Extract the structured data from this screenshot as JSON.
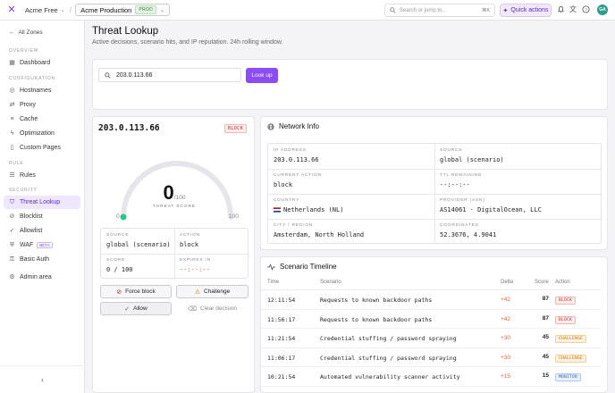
{
  "topbar": {
    "org": "Acme Free",
    "env": "Acme Production",
    "env_badge": "PROD",
    "search_placeholder": "Search or jump to...",
    "search_shortcut": "⌘K",
    "quick_actions": "Quick actions",
    "avatar": "GA"
  },
  "sidebar": {
    "back": "All Zones",
    "sections": {
      "overview": "OVERVIEW",
      "configuration": "CONFIGURATION",
      "rule": "RULE",
      "security": "SECURITY"
    },
    "items": {
      "dashboard": "Dashboard",
      "hostnames": "Hostnames",
      "proxy": "Proxy",
      "cache": "Cache",
      "optimization": "Optimization",
      "custom_pages": "Custom Pages",
      "rules": "Rules",
      "threat_lookup": "Threat Lookup",
      "blocklist": "Blocklist",
      "allowlist": "Allowlist",
      "waf": "WAF",
      "waf_badge": "BETA",
      "basic_auth": "Basic Auth",
      "admin_area": "Admin area"
    }
  },
  "page": {
    "title": "Threat Lookup",
    "subtitle": "Active decisions, scenario hits, and IP reputation. 24h rolling window."
  },
  "lookup": {
    "value": "203.0.113.66",
    "button": "Look up"
  },
  "ipcard": {
    "ip": "203.0.113.66",
    "status": "BLOCK",
    "score": "0",
    "score_max": "/100",
    "score_label": "THREAT SCORE",
    "gauge_min": "0",
    "gauge_max": "100",
    "score_value": 0,
    "source_label": "SOURCE",
    "source": "global (scenario)",
    "action_label": "ACTION",
    "action": "block",
    "score2_label": "SCORE",
    "score2": "0 / 100",
    "expires_label": "EXPIRES IN",
    "expires": "--:--:--",
    "force_block": "Force block",
    "challenge": "Challenge",
    "allow": "Allow",
    "clear": "Clear decision"
  },
  "network": {
    "title": "Network Info",
    "ip_label": "IP ADDRESS",
    "ip": "203.0.113.66",
    "source_label": "SOURCE",
    "source": "global (scenario)",
    "current_action_label": "CURRENT ACTION",
    "current_action": "block",
    "ttl_label": "TTL REMAINING",
    "ttl": "--:--:--",
    "country_label": "COUNTRY",
    "country": "Netherlands (NL)",
    "provider_label": "PROVIDER (ASN)",
    "provider": "AS14061 · DigitalOcean, LLC",
    "city_label": "CITY / REGION",
    "city": "Amsterdam, North Holland",
    "coords_label": "COORDINATES",
    "coords": "52.3676, 4.9041"
  },
  "timeline": {
    "title": "Scenario Timeline",
    "columns": {
      "time": "Time",
      "scenario": "Scenario",
      "delta": "Delta",
      "score": "Score",
      "action": "Action"
    },
    "rows": [
      {
        "time": "12:11:54",
        "scenario": "Requests to known backdoor paths",
        "delta": "+42",
        "score": "87",
        "action": "BLOCK"
      },
      {
        "time": "11:56:17",
        "scenario": "Requests to known backdoor paths",
        "delta": "+42",
        "score": "87",
        "action": "BLOCK"
      },
      {
        "time": "11:21:54",
        "scenario": "Credential stuffing / password spraying",
        "delta": "+30",
        "score": "45",
        "action": "CHALLENGE"
      },
      {
        "time": "11:06:17",
        "scenario": "Credential stuffing / password spraying",
        "delta": "+30",
        "score": "45",
        "action": "CHALLENGE"
      },
      {
        "time": "10:21:54",
        "scenario": "Automated vulnerability scanner activity",
        "delta": "+15",
        "score": "15",
        "action": "MONITOR"
      },
      {
        "time": "10:06:17",
        "scenario": "Automated vulnerability scanner activity",
        "delta": "+15",
        "score": "15",
        "action": "MONITOR"
      }
    ]
  },
  "colors": {
    "accent": "#8b4cf6",
    "gauge_marker": "#2cc48a",
    "delta": "#e0673f"
  }
}
